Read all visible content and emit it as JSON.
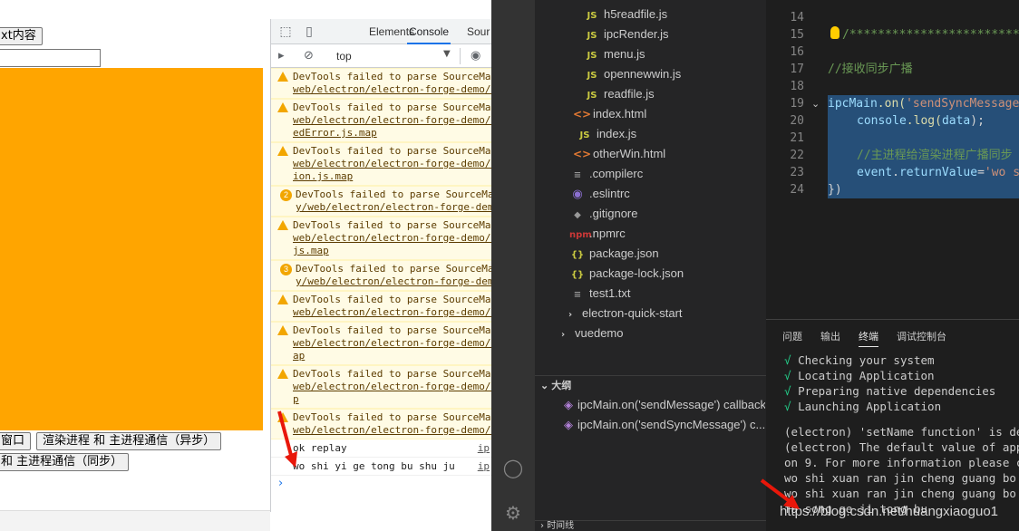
{
  "app": {
    "button_top": "xt内容",
    "button_window": "窗口",
    "button_async": "渲染进程 和 主进程通信（异步）",
    "button_sync": "和 主进程通信（同步）",
    "orange_color": "#ffa500"
  },
  "devtools": {
    "tabs": [
      "Elements",
      "Console",
      "Sour"
    ],
    "context": "top",
    "messages": [
      {
        "count": null,
        "text": "DevTools failed to parse SourceMap",
        "link": "web/electron/electron-forge-demo/s",
        "extra": ""
      },
      {
        "count": null,
        "text": "DevTools failed to parse SourceMap",
        "link": "web/electron/electron-forge-demo/s",
        "extra": "edError.js.map"
      },
      {
        "count": null,
        "text": "DevTools failed to parse SourceMap",
        "link": "web/electron/electron-forge-demo/s",
        "extra": "ion.js.map"
      },
      {
        "count": "2",
        "text": "DevTools failed to parse SourceMa",
        "link": "y/web/electron/electron-forge-demo",
        "extra": ""
      },
      {
        "count": null,
        "text": "DevTools failed to parse SourceMap",
        "link": "web/electron/electron-forge-demo/s",
        "extra": "js.map"
      },
      {
        "count": "3",
        "text": "DevTools failed to parse SourceMa",
        "link": "y/web/electron/electron-forge-demo",
        "extra": ""
      },
      {
        "count": null,
        "text": "DevTools failed to parse SourceMap",
        "link": "web/electron/electron-forge-demo/s",
        "extra": ""
      },
      {
        "count": null,
        "text": "DevTools failed to parse SourceMap",
        "link": "web/electron/electron-forge-demo/s",
        "extra": "ap"
      },
      {
        "count": null,
        "text": "DevTools failed to parse SourceMap",
        "link": "web/electron/electron-forge-demo/s",
        "extra": "p"
      },
      {
        "count": null,
        "text": "DevTools failed to parse SourceMap",
        "link": "web/electron/electron-forge-demo/s",
        "extra": ""
      }
    ],
    "logs": [
      {
        "text": "ok replay",
        "src": "ip"
      },
      {
        "text": "wo shi yi ge tong bu shu ju",
        "src": "ip"
      }
    ],
    "prompt": "›"
  },
  "explorer": {
    "files": [
      {
        "name": "h5readfile.js",
        "icon": "JS",
        "type": "js"
      },
      {
        "name": "ipcRender.js",
        "icon": "JS",
        "type": "js"
      },
      {
        "name": "menu.js",
        "icon": "JS",
        "type": "js"
      },
      {
        "name": "opennewwin.js",
        "icon": "JS",
        "type": "js"
      },
      {
        "name": "readfile.js",
        "icon": "JS",
        "type": "js"
      },
      {
        "name": "index.html",
        "icon": "<>",
        "type": "html"
      },
      {
        "name": "index.js",
        "icon": "JS",
        "type": "js"
      },
      {
        "name": "otherWin.html",
        "icon": "<>",
        "type": "html"
      },
      {
        "name": ".compilerc",
        "icon": "≡",
        "type": "cfg"
      },
      {
        "name": ".eslintrc",
        "icon": "◉",
        "type": "eslint"
      },
      {
        "name": ".gitignore",
        "icon": "◆",
        "type": "cfg"
      },
      {
        "name": ".npmrc",
        "icon": "npm",
        "type": "npm"
      },
      {
        "name": "package.json",
        "icon": "{}",
        "type": "json"
      },
      {
        "name": "package-lock.json",
        "icon": "{}",
        "type": "json"
      },
      {
        "name": "test1.txt",
        "icon": "≡",
        "type": "cfg"
      },
      {
        "name": "electron-quick-start",
        "icon": "›",
        "type": "folder"
      },
      {
        "name": "vuedemo",
        "icon": "›",
        "type": "folder"
      }
    ],
    "outline_title": "大纲",
    "outline_items": [
      "ipcMain.on('sendMessage') callback",
      "ipcMain.on('sendSyncMessage') c..."
    ],
    "timeline_title": "时间线"
  },
  "editor": {
    "line_numbers": [
      "14",
      "15",
      "16",
      "17",
      "18",
      "19",
      "20",
      "21",
      "22",
      "23",
      "24"
    ],
    "line15": "/*****************************",
    "line17": "//接收同步广播",
    "line19_fn": "ipcMain",
    "line19_rest": ".on(",
    "line19_str": "'sendSyncMessage",
    "line20_a": "console",
    "line20_b": ".log(",
    "line20_c": "data",
    "line20_d": ");",
    "line22": "//主进程给渲染进程广播同步",
    "line23_a": "event",
    "line23_b": ".",
    "line23_c": "returnValue",
    "line23_d": "=",
    "line23_e": "'wo sh",
    "line24": "})"
  },
  "panel": {
    "tabs": [
      "问题",
      "输出",
      "终端",
      "调试控制台"
    ],
    "active_tab": "终端",
    "check_lines": [
      "Checking your system",
      "Locating Application",
      "Preparing native dependencies",
      "Launching Application"
    ],
    "check_mark": "√",
    "lines": [
      "(electron) 'setName function' is depr",
      "(electron) The default value of app.a",
      "on 9.  For more information please ch",
      "wo shi xuan ran jin cheng guang bo sh",
      "wo shi xuan ran jin cheng guang bo sh",
      "fa song ge ji tong bu"
    ],
    "watermark": "https://blog.csdn.net/huangxiaoguo1"
  }
}
